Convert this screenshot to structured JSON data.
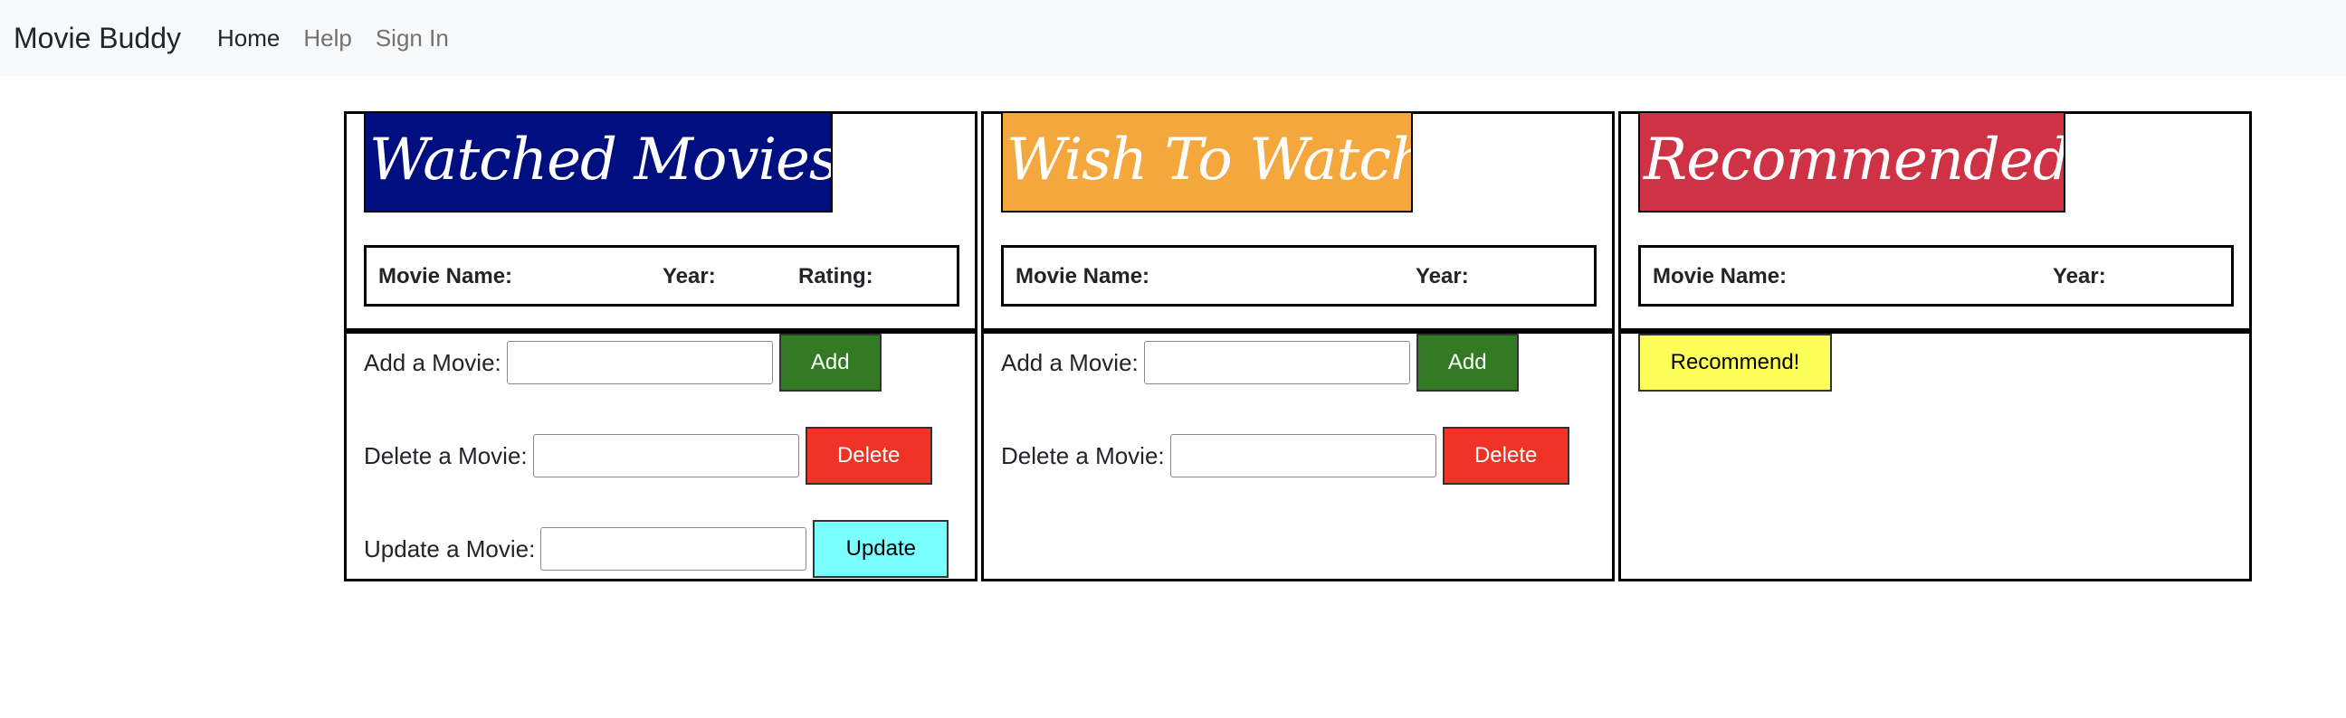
{
  "navbar": {
    "brand": "Movie Buddy",
    "links": [
      {
        "label": "Home",
        "active": true
      },
      {
        "label": "Help",
        "active": false
      },
      {
        "label": "Sign In",
        "active": false
      }
    ]
  },
  "watched": {
    "title": "Watched Movies:",
    "header_color": "#000f80",
    "columns": {
      "name": "Movie Name:",
      "year": "Year:",
      "rating": "Rating:"
    },
    "add_label": "Add a Movie:",
    "add_value": "",
    "add_button": "Add",
    "delete_label": "Delete a Movie:",
    "delete_value": "",
    "delete_button": "Delete",
    "update_label": "Update a Movie:",
    "update_value": "",
    "update_button": "Update"
  },
  "wish": {
    "title": "Wish To Watch:",
    "header_color": "#f4a73d",
    "columns": {
      "name": "Movie Name:",
      "year": "Year:"
    },
    "add_label": "Add a Movie:",
    "add_value": "",
    "add_button": "Add",
    "delete_label": "Delete a Movie:",
    "delete_value": "",
    "delete_button": "Delete"
  },
  "recommended": {
    "title": "Recommended:",
    "header_color": "#d03245",
    "columns": {
      "name": "Movie Name:",
      "year": "Year:"
    },
    "recommend_button": "Recommend!"
  },
  "colors": {
    "add_button": "#347a24",
    "delete_button": "#ee3226",
    "update_button": "#7afefe",
    "recommend_button": "#fefe58",
    "navbar_bg": "#f8f9fa"
  }
}
